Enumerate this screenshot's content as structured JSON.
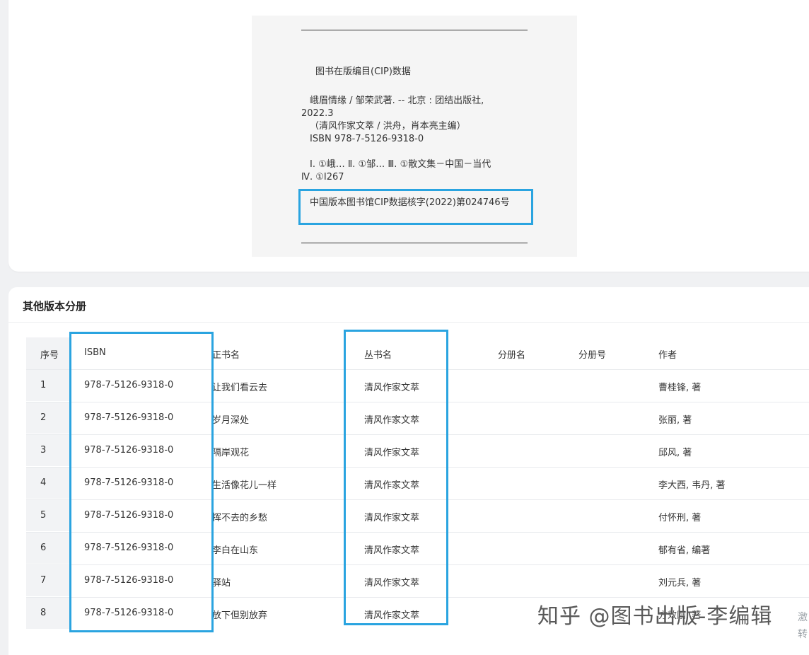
{
  "cip": {
    "heading": "图书在版编目(CIP)数据",
    "line1": "峨眉情缘 / 邹荣武著. -- 北京 : 团结出版社,",
    "line2": "2022.3",
    "line3": "（清风作家文萃 / 洪舟，肖本亮主编）",
    "line4": "ISBN 978-7-5126-9318-0",
    "line5": "Ⅰ. ①峨… Ⅱ. ①邹… Ⅲ. ①散文集－中国－当代",
    "line6": "Ⅳ. ①I267",
    "approval": "中国版本图书馆CIP数据核字(2022)第024746号"
  },
  "section": {
    "title": "其他版本分册"
  },
  "table": {
    "headers": {
      "seq": "序号",
      "isbn": "ISBN",
      "title": "正书名",
      "series": "丛书名",
      "volume_name": "分册名",
      "volume_no": "分册号",
      "author": "作者"
    },
    "rows": [
      {
        "seq": "1",
        "isbn": "978-7-5126-9318-0",
        "title": "让我们看云去",
        "series": "清风作家文萃",
        "author": "曹桂锋, 著"
      },
      {
        "seq": "2",
        "isbn": "978-7-5126-9318-0",
        "title": "岁月深处",
        "series": "清风作家文萃",
        "author": "张丽, 著"
      },
      {
        "seq": "3",
        "isbn": "978-7-5126-9318-0",
        "title": "隔岸观花",
        "series": "清风作家文萃",
        "author": "邱风, 著"
      },
      {
        "seq": "4",
        "isbn": "978-7-5126-9318-0",
        "title": "生活像花儿一样",
        "series": "清风作家文萃",
        "author": "李大西, 韦丹, 著"
      },
      {
        "seq": "5",
        "isbn": "978-7-5126-9318-0",
        "title": "挥不去的乡愁",
        "series": "清风作家文萃",
        "author": "付怀刑, 著"
      },
      {
        "seq": "6",
        "isbn": "978-7-5126-9318-0",
        "title": "李白在山东",
        "series": "清风作家文萃",
        "author": "郁有省, 编著"
      },
      {
        "seq": "7",
        "isbn": "978-7-5126-9318-0",
        "title": "驿站",
        "series": "清风作家文萃",
        "author": "刘元兵, 著"
      },
      {
        "seq": "8",
        "isbn": "978-7-5126-9318-0",
        "title": "放下但别放弃",
        "series": "清风作家文萃",
        "author": "方效刚, 著"
      }
    ]
  },
  "watermark": {
    "text": "知乎 @图书出版-李编辑",
    "side1": "激",
    "side2": "转"
  },
  "colors": {
    "highlight": "#2aa4e0"
  }
}
